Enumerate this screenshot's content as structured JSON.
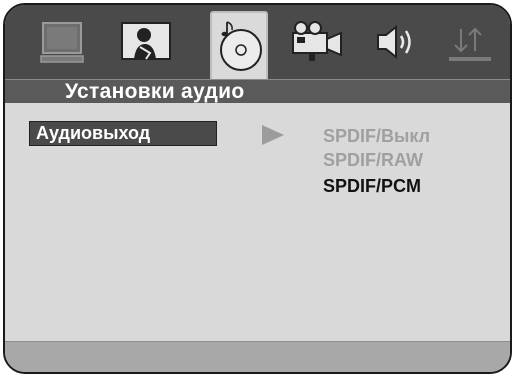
{
  "header": {
    "tabs": [
      {
        "icon": "monitor-icon",
        "label": ""
      },
      {
        "icon": "person-tv-icon",
        "label": ""
      },
      {
        "icon": "music-disc-icon",
        "label": "",
        "selected": true
      },
      {
        "icon": "video-camera-icon",
        "label": ""
      },
      {
        "icon": "speaker-icon",
        "label": ""
      },
      {
        "icon": "up-down-arrows-icon",
        "label": ""
      }
    ]
  },
  "title": "Установки аудио",
  "menu": {
    "items": [
      {
        "label": "Аудиовыход",
        "selected": true
      }
    ]
  },
  "options": [
    {
      "label": "SPDIF/Выкл",
      "state": "dim"
    },
    {
      "label": "SPDIF/RAW",
      "state": "dim"
    },
    {
      "label": "SPDIF/PCM",
      "state": "active"
    }
  ],
  "colors": {
    "frame": "#1a1a1a",
    "icon_bar": "#4a4a4a",
    "title_bar": "#5a5a5a",
    "content": "#d9d9d9",
    "dim_text": "#a0a0a0",
    "active_text": "#111111"
  }
}
